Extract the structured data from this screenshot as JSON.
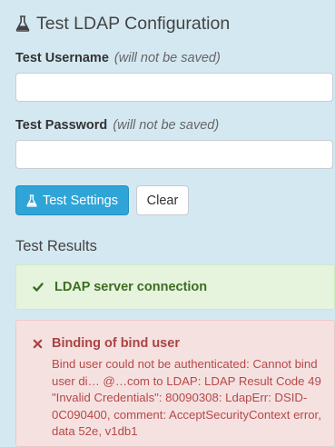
{
  "title": "Test LDAP Configuration",
  "username": {
    "label": "Test Username",
    "hint": "(will not be saved)",
    "value": "",
    "placeholder": ""
  },
  "password": {
    "label": "Test Password",
    "hint": "(will not be saved)",
    "value": "",
    "placeholder": ""
  },
  "buttons": {
    "test_settings": "Test Settings",
    "clear": "Clear"
  },
  "results": {
    "title": "Test Results",
    "success": {
      "label": "LDAP server connection",
      "color": "#3c6e22"
    },
    "failure": {
      "label": "Binding of bind user",
      "message": "Bind user could not be authenticated: Cannot bind user di… @…com to LDAP: LDAP Result Code 49 \"Invalid Credentials\": 80090308: LdapErr: DSID-0C090400, comment: AcceptSecurityContext error, data 52e, v1db1",
      "color": "#a94442"
    }
  },
  "icons": {
    "title": "flask-icon",
    "test_button": "flask-icon",
    "success": "check-icon",
    "failure": "x-icon"
  },
  "colors": {
    "background": "#d4e8f1",
    "primary": "#2fa4d7"
  }
}
